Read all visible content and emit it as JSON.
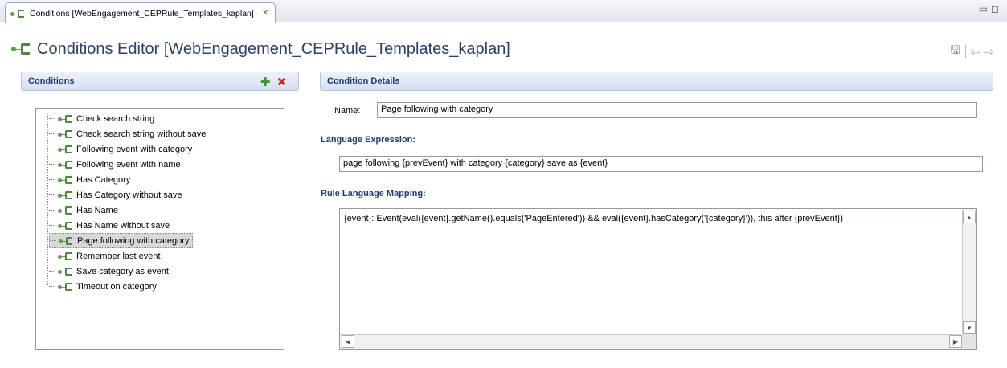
{
  "tab": {
    "title": "Conditions [WebEngagement_CEPRule_Templates_kaplan]",
    "close_glyph": "✕"
  },
  "window_controls": {
    "minimize_glyph": "▭",
    "maximize_glyph": "◻"
  },
  "editor": {
    "title": "Conditions Editor [WebEngagement_CEPRule_Templates_kaplan]",
    "toolbar_icons": [
      "save-icon",
      "undo-arrow-icon",
      "redo-arrow-icon"
    ],
    "save_glyph": "🖫",
    "back_glyph": "⇦",
    "forward_glyph": "⇨"
  },
  "conditions_panel": {
    "title": "Conditions",
    "add_glyph": "✚",
    "delete_glyph": "✖",
    "items": [
      {
        "label": "Check search string"
      },
      {
        "label": "Check search string without save"
      },
      {
        "label": "Following event with category"
      },
      {
        "label": "Following event with name"
      },
      {
        "label": "Has Category"
      },
      {
        "label": "Has Category without save"
      },
      {
        "label": "Has Name"
      },
      {
        "label": "Has Name without save"
      },
      {
        "label": "Page following with category",
        "selected": true
      },
      {
        "label": "Remember last event"
      },
      {
        "label": "Save category as event"
      },
      {
        "label": "Timeout on category"
      }
    ]
  },
  "details_panel": {
    "title": "Condition Details",
    "name_label": "Name:",
    "name_value": "Page following with category",
    "language_expression_title": "Language Expression:",
    "language_expression_value": "page following {prevEvent} with category {category} save as {event}",
    "rule_mapping_title": "Rule Language Mapping:",
    "rule_mapping_value": "{event}: Event(eval({event}.getName().equals('PageEntered')) && eval({event}.hasCategory('{category}')), this after {prevEvent})",
    "scroll_up_glyph": "▲",
    "scroll_down_glyph": "▼",
    "scroll_left_glyph": "◀",
    "scroll_right_glyph": "▶"
  },
  "colors": {
    "header_text": "#1f3b70",
    "add_icon": "#3c9a2c",
    "delete_icon": "#d82a1f",
    "tree_icon": "#57a24a"
  }
}
